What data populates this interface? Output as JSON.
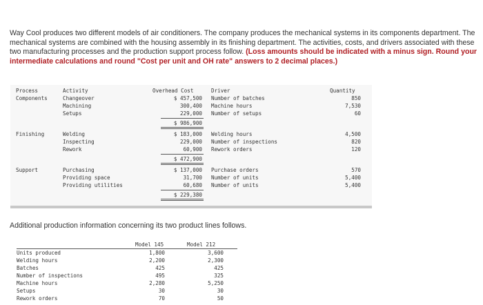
{
  "intro": {
    "text": "Way Cool produces two different models of air conditioners. The company produces the mechanical systems in its components department. The mechanical systems are combined with the housing assembly in its finishing department. The activities, costs, and drivers associated with these two manufacturing processes and the production support process follow.",
    "note": "(Loss amounts should be indicated with a minus sign. Round your intermediate calculations and round \"Cost per unit and OH rate\" answers to 2 decimal places.)"
  },
  "activity_table": {
    "headers": {
      "process": "Process",
      "activity": "Activity",
      "cost": "Overhead Cost",
      "driver": "Driver",
      "quantity": "Quantity"
    },
    "rows": [
      {
        "process": "Components",
        "activity": "Changeover",
        "cost": "$ 457,500",
        "driver": "Number of batches",
        "quantity": "850"
      },
      {
        "process": "",
        "activity": "Machining",
        "cost": "300,400",
        "driver": "Machine hours",
        "quantity": "7,530"
      },
      {
        "process": "",
        "activity": "Setups",
        "cost": "229,000",
        "driver": "Number of setups",
        "quantity": "60"
      },
      {
        "process": "",
        "activity": "",
        "cost": "$ 986,900",
        "driver": "",
        "quantity": ""
      },
      {
        "process": "Finishing",
        "activity": "Welding",
        "cost": "$ 183,000",
        "driver": "Welding hours",
        "quantity": "4,500"
      },
      {
        "process": "",
        "activity": "Inspecting",
        "cost": "229,000",
        "driver": "Number of inspections",
        "quantity": "820"
      },
      {
        "process": "",
        "activity": "Rework",
        "cost": "60,900",
        "driver": "Rework orders",
        "quantity": "120"
      },
      {
        "process": "",
        "activity": "",
        "cost": "$ 472,900",
        "driver": "",
        "quantity": ""
      },
      {
        "process": "Support",
        "activity": "Purchasing",
        "cost": "$ 137,000",
        "driver": "Purchase orders",
        "quantity": "570"
      },
      {
        "process": "",
        "activity": "Providing space",
        "cost": "31,700",
        "driver": "Number of units",
        "quantity": "5,400"
      },
      {
        "process": "",
        "activity": "Providing utilities",
        "cost": "60,680",
        "driver": "Number of units",
        "quantity": "5,400"
      },
      {
        "process": "",
        "activity": "",
        "cost": "$ 229,380",
        "driver": "",
        "quantity": ""
      }
    ]
  },
  "middle_text": "Additional production information concerning its two product lines follows.",
  "production_table": {
    "headers": {
      "label": "",
      "model1": "Model 145",
      "model2": "Model 212"
    },
    "rows": [
      {
        "label": "Units produced",
        "model1": "1,800",
        "model2": "3,600"
      },
      {
        "label": "Welding hours",
        "model1": "2,200",
        "model2": "2,300"
      },
      {
        "label": "Batches",
        "model1": "425",
        "model2": "425"
      },
      {
        "label": "Number of inspections",
        "model1": "495",
        "model2": "325"
      },
      {
        "label": "Machine hours",
        "model1": "2,280",
        "model2": "5,250"
      },
      {
        "label": "Setups",
        "model1": "30",
        "model2": "30"
      },
      {
        "label": "Rework orders",
        "model1": "70",
        "model2": "50"
      }
    ]
  }
}
